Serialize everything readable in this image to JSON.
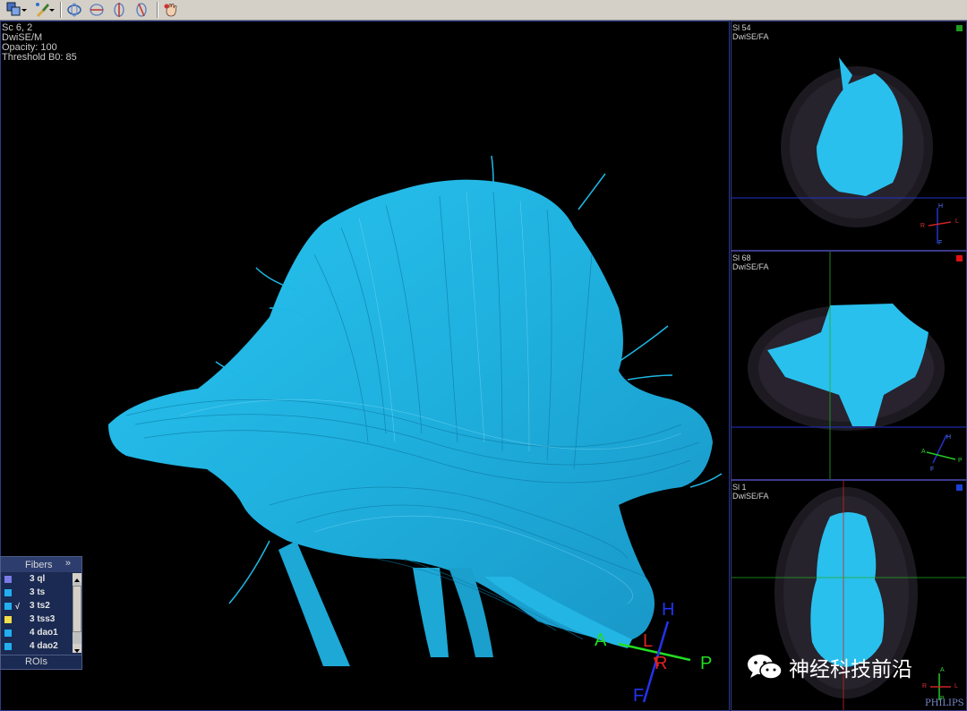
{
  "toolbar": {
    "buttons": [
      {
        "icon": "layout-icon",
        "has_dropdown": true
      },
      {
        "icon": "brush-icon",
        "has_dropdown": true
      },
      {
        "icon": "sphere-rotate-icon",
        "has_dropdown": false
      },
      {
        "icon": "axial-view-icon",
        "has_dropdown": false
      },
      {
        "icon": "sagittal-view-icon",
        "has_dropdown": false
      },
      {
        "icon": "coronal-view-icon",
        "has_dropdown": false
      },
      {
        "icon": "hand-pan-icon",
        "has_dropdown": false
      }
    ]
  },
  "main_view": {
    "info": {
      "line1": "Sc 6, 2",
      "line2": "DwiSE/M",
      "line3": "Opacity: 100",
      "line4": "Threshold B0: 85"
    },
    "orientation": {
      "A": "A",
      "P": "P",
      "H": "H",
      "F": "F",
      "L": "L",
      "R": "R"
    },
    "fiber_color": "#1fb8e6"
  },
  "side_views": [
    {
      "slice": "Sl 54",
      "series": "DwiSE/FA",
      "marker_color": "#1e9a1e"
    },
    {
      "slice": "Sl 68",
      "series": "DwiSE/FA",
      "marker_color": "#e01010"
    },
    {
      "slice": "Sl 1",
      "series": "DwiSE/FA",
      "marker_color": "#1a40d8"
    }
  ],
  "fibers_panel": {
    "title": "Fibers",
    "collapse_label": "»",
    "items": [
      {
        "label": "3 ql",
        "color": "#7b7be8",
        "checked": ""
      },
      {
        "label": "3 ts",
        "color": "#22aef0",
        "checked": ""
      },
      {
        "label": "3 ts2",
        "color": "#22aef0",
        "checked": "√"
      },
      {
        "label": "3 tss3",
        "color": "#f2dd4a",
        "checked": ""
      },
      {
        "label": "4 dao1",
        "color": "#22aef0",
        "checked": ""
      },
      {
        "label": "4 dao2",
        "color": "#22aef0",
        "checked": ""
      }
    ],
    "rois_label": "ROIs"
  },
  "watermark": {
    "text": "神经科技前沿"
  },
  "brand": {
    "text": "PHILIPS"
  },
  "mini_axes": {
    "view1": {
      "H": "H",
      "R": "R",
      "L": "L",
      "F": "F"
    },
    "view2": {
      "H": "H",
      "A": "A",
      "P": "P",
      "F": "F"
    },
    "view3": {
      "A": "A",
      "R": "R",
      "L": "L",
      "P": "P"
    }
  }
}
